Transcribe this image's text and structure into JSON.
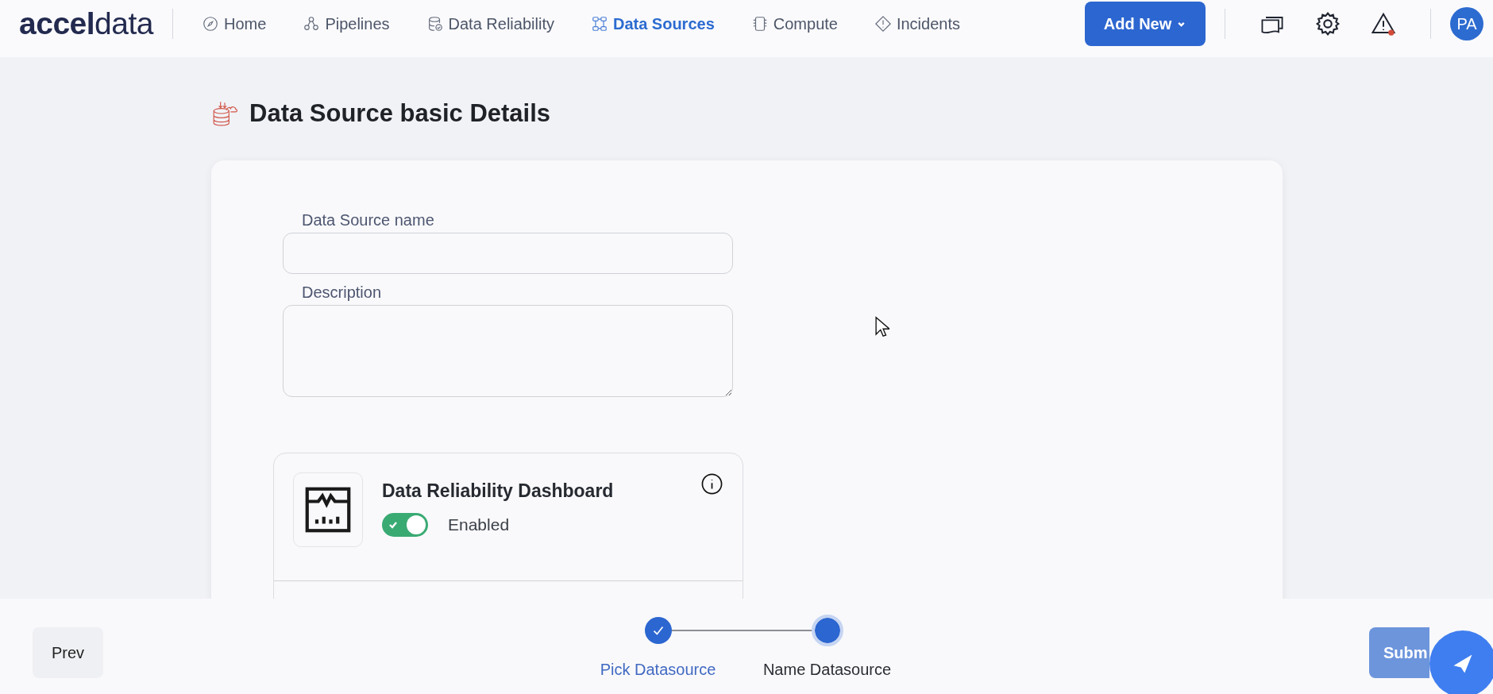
{
  "logo": "**accel**data",
  "nav": [
    {
      "label": "Home",
      "selected": false
    },
    {
      "label": "Pipelines",
      "selected": false
    },
    {
      "label": "Data Reliability",
      "selected": false
    },
    {
      "label": "Data Sources",
      "selected": true
    },
    {
      "label": "Compute",
      "selected": false
    },
    {
      "label": "Incidents",
      "selected": false
    }
  ],
  "add_button": "Add New",
  "alert_unread": true,
  "avatar": "PA",
  "page_title": "Data Source basic Details",
  "form": {
    "fields": [
      {
        "label": "Data Source name",
        "kind": "input"
      },
      {
        "label": "Description",
        "kind": "textarea"
      }
    ]
  },
  "feature_card": {
    "title": "Data Reliability Dashboard",
    "enabled": true,
    "status": "Enabled"
  },
  "footer": {
    "prev": "Prev",
    "submit": "Subm",
    "steps": [
      {
        "label": "Pick Datasource",
        "done": true
      },
      {
        "label": "Name Datasource",
        "done": false
      }
    ]
  }
}
